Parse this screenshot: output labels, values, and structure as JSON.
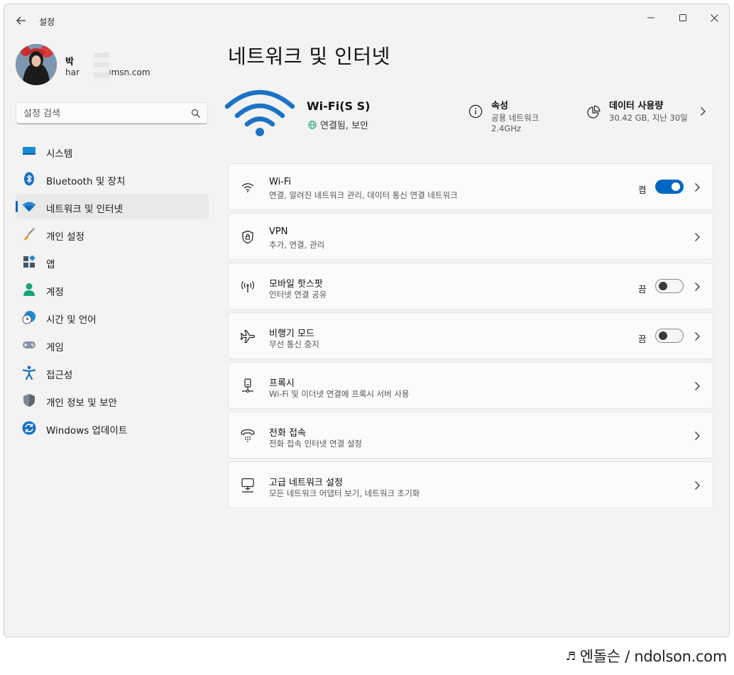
{
  "window": {
    "app_title": "설정"
  },
  "profile": {
    "name": "박",
    "email_prefix": "har",
    "email_suffix": "ii@msn.com"
  },
  "search": {
    "placeholder": "설정 검색"
  },
  "nav": {
    "items": [
      {
        "label": "시스템",
        "icon": "monitor-icon"
      },
      {
        "label": "Bluetooth 및 장치",
        "icon": "bluetooth-icon"
      },
      {
        "label": "네트워크 및 인터넷",
        "icon": "wifi-icon",
        "active": true
      },
      {
        "label": "개인 설정",
        "icon": "brush-icon"
      },
      {
        "label": "앱",
        "icon": "apps-icon"
      },
      {
        "label": "계정",
        "icon": "person-icon"
      },
      {
        "label": "시간 및 언어",
        "icon": "clock-globe-icon"
      },
      {
        "label": "게임",
        "icon": "gamepad-icon"
      },
      {
        "label": "접근성",
        "icon": "accessibility-icon"
      },
      {
        "label": "개인 정보 및 보안",
        "icon": "shield-icon"
      },
      {
        "label": "Windows 업데이트",
        "icon": "update-icon"
      }
    ]
  },
  "main": {
    "title": "네트워크 및 인터넷",
    "connection": {
      "ssid": "Wi-Fi(S  S)",
      "status": "연결됨, 보안"
    },
    "properties": {
      "title": "속성",
      "line1": "공용 네트워크",
      "line2": "2.4GHz"
    },
    "data_usage": {
      "title": "데이터 사용량",
      "detail": "30.42 GB, 지난 30일"
    },
    "cards": [
      {
        "title": "Wi-Fi",
        "subtitle": "연결, 알려진 네트워크 관리, 데이터 통신 연결 네트워크",
        "icon": "wifi-icon",
        "toggle": {
          "label": "켬",
          "on": true
        }
      },
      {
        "title": "VPN",
        "subtitle": "추가, 연결, 관리",
        "icon": "vpn-shield-icon"
      },
      {
        "title": "모바일 핫스팟",
        "subtitle": "인터넷 연결 공유",
        "icon": "hotspot-icon",
        "toggle": {
          "label": "끔",
          "on": false
        }
      },
      {
        "title": "비행기 모드",
        "subtitle": "무선 통신 중지",
        "icon": "airplane-icon",
        "toggle": {
          "label": "끔",
          "on": false
        }
      },
      {
        "title": "프록시",
        "subtitle": "Wi-Fi 및 이더넷 연결에 프록시 서버 사용",
        "icon": "proxy-icon"
      },
      {
        "title": "전화 접속",
        "subtitle": "전화 접속 인터넷 연결 설정",
        "icon": "dialup-icon"
      },
      {
        "title": "고급 네트워크 설정",
        "subtitle": "모든 네트워크 어댑터 보기, 네트워크 초기화",
        "icon": "network-pc-icon"
      }
    ]
  },
  "watermark": {
    "text": "엔돌슨 / ndolson.com"
  },
  "colors": {
    "accent": "#0067c0",
    "window_bg": "#f3f3f3",
    "card_bg": "#fbfbfb"
  }
}
